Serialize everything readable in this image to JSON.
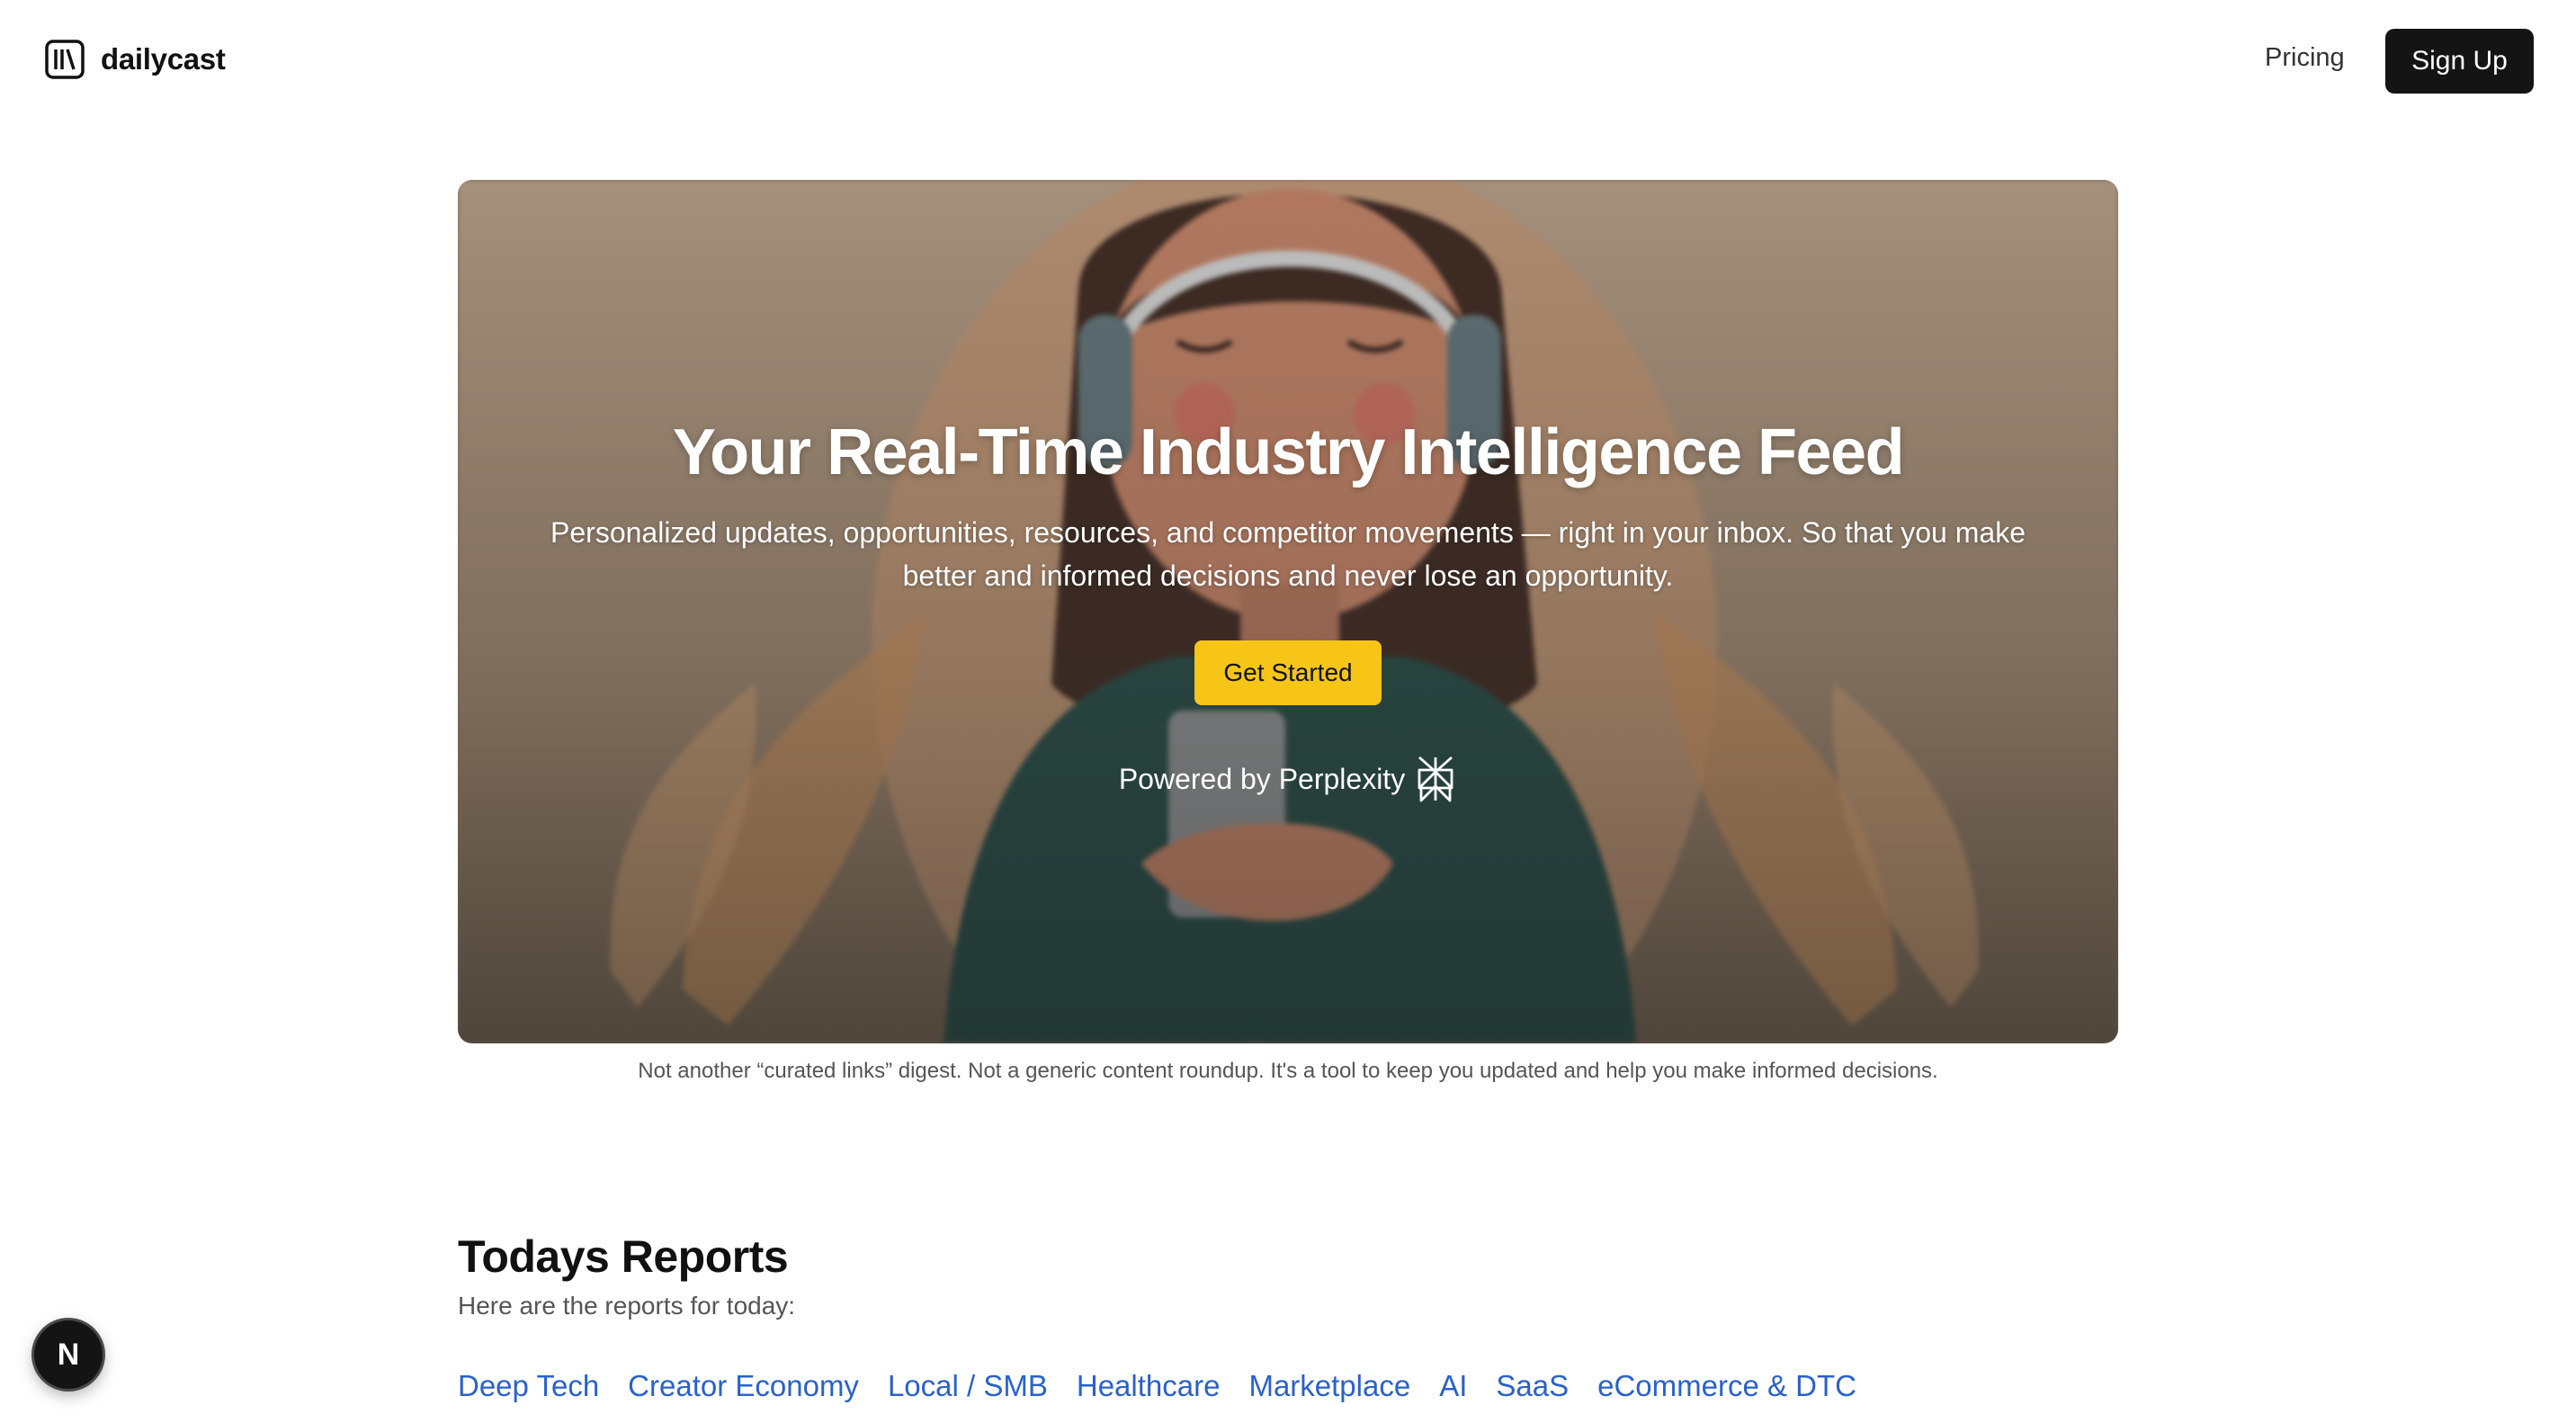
{
  "header": {
    "brand": "dailycast",
    "logo_icon": "library-books-icon",
    "pricing_label": "Pricing",
    "signup_label": "Sign Up"
  },
  "hero": {
    "title": "Your Real-Time Industry Intelligence Feed",
    "subtitle": "Personalized updates, opportunities, resources, and competitor movements — right in your inbox. So that you make better and informed decisions and never lose an opportunity.",
    "cta_label": "Get Started",
    "powered_by": "Powered by Perplexity",
    "powered_icon": "perplexity-logo-icon",
    "cta_color": "#f6c518"
  },
  "tagline": "Not another “curated links” digest. Not a generic content roundup. It's a tool to keep you updated and help you make informed decisions.",
  "reports": {
    "title": "Todays Reports",
    "subtitle": "Here are the reports for today:",
    "categories": [
      "Deep Tech",
      "Creator Economy",
      "Local / SMB",
      "Healthcare",
      "Marketplace",
      "AI",
      "SaaS",
      "eCommerce & DTC"
    ],
    "link_color": "#2962c9"
  },
  "dev_badge": {
    "label": "N",
    "icon": "nextjs-logo-icon"
  }
}
